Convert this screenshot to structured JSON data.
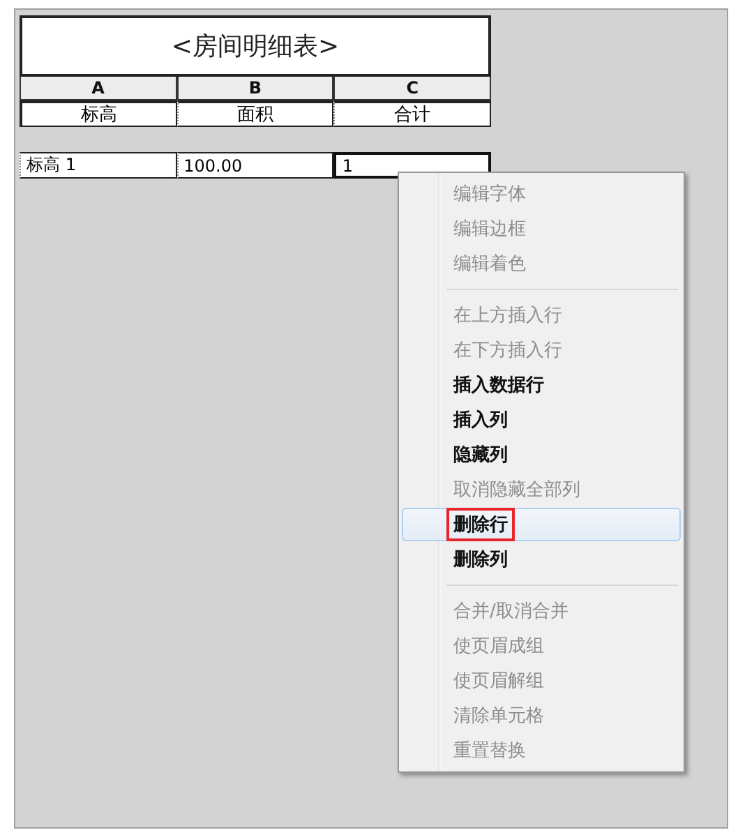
{
  "schedule": {
    "title": "<房间明细表>",
    "column_letters": [
      "A",
      "B",
      "C"
    ],
    "headers": [
      "标高",
      "面积",
      "合计"
    ],
    "rows": [
      [
        {
          "text": "标高 1",
          "selected": false
        },
        {
          "text": "100.00",
          "selected": false
        },
        {
          "text": "1",
          "selected": true
        }
      ]
    ]
  },
  "context_menu": {
    "groups": [
      [
        {
          "label": "编辑字体",
          "disabled": true,
          "selected": false,
          "marked": false
        },
        {
          "label": "编辑边框",
          "disabled": true,
          "selected": false,
          "marked": false
        },
        {
          "label": "编辑着色",
          "disabled": true,
          "selected": false,
          "marked": false
        }
      ],
      [
        {
          "label": "在上方插入行",
          "disabled": true,
          "selected": false,
          "marked": false
        },
        {
          "label": "在下方插入行",
          "disabled": true,
          "selected": false,
          "marked": false
        },
        {
          "label": "插入数据行",
          "disabled": false,
          "selected": false,
          "marked": false
        },
        {
          "label": "插入列",
          "disabled": false,
          "selected": false,
          "marked": false
        },
        {
          "label": "隐藏列",
          "disabled": false,
          "selected": false,
          "marked": false
        },
        {
          "label": "取消隐藏全部列",
          "disabled": true,
          "selected": false,
          "marked": false
        },
        {
          "label": "删除行",
          "disabled": false,
          "selected": true,
          "marked": true
        },
        {
          "label": "删除列",
          "disabled": false,
          "selected": false,
          "marked": false
        }
      ],
      [
        {
          "label": "合并/取消合并",
          "disabled": true,
          "selected": false,
          "marked": false
        },
        {
          "label": "使页眉成组",
          "disabled": true,
          "selected": false,
          "marked": false
        },
        {
          "label": "使页眉解组",
          "disabled": true,
          "selected": false,
          "marked": false
        },
        {
          "label": "清除单元格",
          "disabled": true,
          "selected": false,
          "marked": false
        },
        {
          "label": "重置替换",
          "disabled": true,
          "selected": false,
          "marked": false
        }
      ]
    ]
  }
}
